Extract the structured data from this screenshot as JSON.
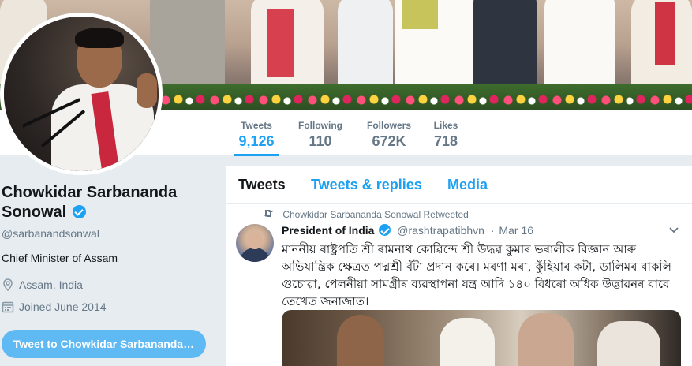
{
  "profile": {
    "name": "Chowkidar Sarbananda Sonowal",
    "handle": "@sarbanandsonwal",
    "bio": "Chief Minister of Assam",
    "location": "Assam, India",
    "joined": "Joined June 2014",
    "tweet_to_label": "Tweet to Chowkidar Sarbananda­…"
  },
  "stats": [
    {
      "label": "Tweets",
      "value": "9,126"
    },
    {
      "label": "Following",
      "value": "110"
    },
    {
      "label": "Followers",
      "value": "672K"
    },
    {
      "label": "Likes",
      "value": "718"
    }
  ],
  "timeline": {
    "tabs": [
      "Tweets",
      "Tweets & replies",
      "Media"
    ],
    "tweet": {
      "retweet_context": "Chowkidar Sarbananda Sonowal Retweeted",
      "author_name": "President of India",
      "author_handle": "@rashtrapatibhvn",
      "date": "Mar 16",
      "text_lines": [
        "মাননীয় ৰাষ্ট্ৰপতি শ্ৰী ৰামনাথ কোৱিন্দে শ্ৰী উদ্ধৱ কুমাৰ ভৰালীক বিজ্ঞান আৰু",
        "অভিযান্ত্ৰিক ক্ষেত্ৰত পদ্মশ্ৰী বঁটা প্ৰদান কৰে। মৰণা মৰা, কুঁহিয়াৰ কটা, ডালিমৰ বাকলি",
        "গুচোৱা, পেলনীয়া সামগ্ৰীৰ ব্যৱস্থাপনা যন্ত্ৰ আদি ১৪০ বিধৰো অধিক উদ্ভাৱনৰ বাবে",
        "তেখেত জনাজাত।"
      ]
    }
  },
  "icons": {
    "location": "location-pin-icon",
    "calendar": "calendar-icon",
    "retweet": "retweet-icon",
    "verified": "verified-badge-icon",
    "caret": "chevron-down-icon"
  },
  "colors": {
    "accent": "#1da1f2",
    "muted": "#657786",
    "background": "#e6ecf0"
  }
}
